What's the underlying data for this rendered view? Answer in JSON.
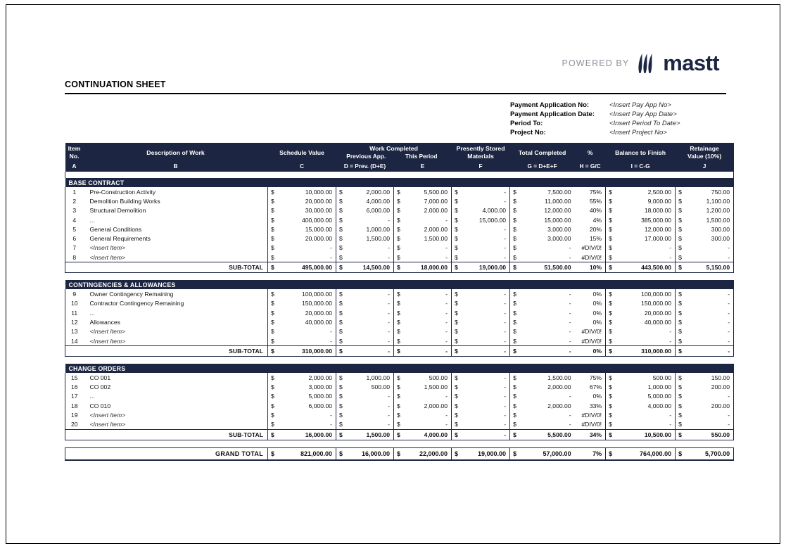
{
  "brand": {
    "powered_by": "POWERED BY",
    "name": "mastt",
    "logo_icon": "mastt-flame-icon",
    "navy": "#1c2642",
    "gray": "#8d9199"
  },
  "page_title": "CONTINUATION SHEET",
  "meta": [
    {
      "label": "Payment Application No:",
      "value": "<Insert Pay App No>"
    },
    {
      "label": "Payment Application Date:",
      "value": "<Insert Pay App Date>"
    },
    {
      "label": "Period To:",
      "value": "<Insert Period To Date>"
    },
    {
      "label": "Project No:",
      "value": "<Insert Project No>"
    }
  ],
  "table": {
    "headers": {
      "item_no_l1": "Item",
      "item_no_l2": "No.",
      "description": "Description of Work",
      "schedule_value": "Schedule Value",
      "work_completed": "Work Completed",
      "previous_app": "Previous App.",
      "this_period": "This Period",
      "stored_l1": "Presently Stored",
      "stored_l2": "Materials",
      "total_completed": "Total Completed",
      "percent": "%",
      "balance_to_finish": "Balance to Finish",
      "retainage_l1": "Retainage",
      "retainage_l2": "Value (10%)"
    },
    "letters": {
      "a": "A",
      "b": "B",
      "c": "C",
      "d": "D = Prev. (D+E)",
      "e": "E",
      "f": "F",
      "g": "G = D+E+F",
      "h": "H = G/C",
      "i": "I = C-G",
      "j": "J"
    },
    "currency_symbol": "$",
    "subtotal_label": "SUB-TOTAL",
    "grand_total_label": "GRAND TOTAL",
    "sections": [
      {
        "title": "BASE CONTRACT",
        "rows": [
          {
            "no": "1",
            "desc": "Pre-Construction Activity",
            "italic": false,
            "sv": "10,000.00",
            "prev": "2,000.00",
            "this": "5,500.00",
            "stored": "-",
            "total": "7,500.00",
            "pct": "75%",
            "bal": "2,500.00",
            "ret": "750.00"
          },
          {
            "no": "2",
            "desc": "Demolition Building Works",
            "italic": false,
            "sv": "20,000.00",
            "prev": "4,000.00",
            "this": "7,000.00",
            "stored": "-",
            "total": "11,000.00",
            "pct": "55%",
            "bal": "9,000.00",
            "ret": "1,100.00"
          },
          {
            "no": "3",
            "desc": "Structural Demolition",
            "italic": false,
            "sv": "30,000.00",
            "prev": "6,000.00",
            "this": "2,000.00",
            "stored": "4,000.00",
            "total": "12,000.00",
            "pct": "40%",
            "bal": "18,000.00",
            "ret": "1,200.00"
          },
          {
            "no": "4",
            "desc": "...",
            "italic": false,
            "sv": "400,000.00",
            "prev": "-",
            "this": "-",
            "stored": "15,000.00",
            "total": "15,000.00",
            "pct": "4%",
            "bal": "385,000.00",
            "ret": "1,500.00"
          },
          {
            "no": "5",
            "desc": "General Conditions",
            "italic": false,
            "sv": "15,000.00",
            "prev": "1,000.00",
            "this": "2,000.00",
            "stored": "-",
            "total": "3,000.00",
            "pct": "20%",
            "bal": "12,000.00",
            "ret": "300.00"
          },
          {
            "no": "6",
            "desc": "General Requirements",
            "italic": false,
            "sv": "20,000.00",
            "prev": "1,500.00",
            "this": "1,500.00",
            "stored": "-",
            "total": "3,000.00",
            "pct": "15%",
            "bal": "17,000.00",
            "ret": "300.00"
          },
          {
            "no": "7",
            "desc": "<Insert Item>",
            "italic": true,
            "sv": "-",
            "prev": "-",
            "this": "-",
            "stored": "-",
            "total": "-",
            "pct": "#DIV/0!",
            "bal": "-",
            "ret": "-"
          },
          {
            "no": "8",
            "desc": "<Insert Item>",
            "italic": true,
            "sv": "-",
            "prev": "-",
            "this": "-",
            "stored": "-",
            "total": "-",
            "pct": "#DIV/0!",
            "bal": "-",
            "ret": "-"
          }
        ],
        "subtotal": {
          "sv": "495,000.00",
          "prev": "14,500.00",
          "this": "18,000.00",
          "stored": "19,000.00",
          "total": "51,500.00",
          "pct": "10%",
          "bal": "443,500.00",
          "ret": "5,150.00"
        }
      },
      {
        "title": "CONTINGENCIES & ALLOWANCES",
        "rows": [
          {
            "no": "9",
            "desc": "Owner Contingency Remaining",
            "italic": false,
            "sv": "100,000.00",
            "prev": "-",
            "this": "-",
            "stored": "-",
            "total": "-",
            "pct": "0%",
            "bal": "100,000.00",
            "ret": "-"
          },
          {
            "no": "10",
            "desc": "Contractor Contingency Remaining",
            "italic": false,
            "sv": "150,000.00",
            "prev": "-",
            "this": "-",
            "stored": "-",
            "total": "-",
            "pct": "0%",
            "bal": "150,000.00",
            "ret": "-"
          },
          {
            "no": "11",
            "desc": "...",
            "italic": false,
            "sv": "20,000.00",
            "prev": "-",
            "this": "-",
            "stored": "-",
            "total": "-",
            "pct": "0%",
            "bal": "20,000.00",
            "ret": "-"
          },
          {
            "no": "12",
            "desc": "Allowances",
            "italic": false,
            "sv": "40,000.00",
            "prev": "-",
            "this": "-",
            "stored": "-",
            "total": "-",
            "pct": "0%",
            "bal": "40,000.00",
            "ret": "-"
          },
          {
            "no": "13",
            "desc": "<Insert Item>",
            "italic": true,
            "sv": "-",
            "prev": "-",
            "this": "-",
            "stored": "-",
            "total": "-",
            "pct": "#DIV/0!",
            "bal": "-",
            "ret": "-"
          },
          {
            "no": "14",
            "desc": "<Insert Item>",
            "italic": true,
            "sv": "-",
            "prev": "-",
            "this": "-",
            "stored": "-",
            "total": "-",
            "pct": "#DIV/0!",
            "bal": "-",
            "ret": "-"
          }
        ],
        "subtotal": {
          "sv": "310,000.00",
          "prev": "-",
          "this": "-",
          "stored": "-",
          "total": "-",
          "pct": "0%",
          "bal": "310,000.00",
          "ret": "-"
        }
      },
      {
        "title": "CHANGE ORDERS",
        "rows": [
          {
            "no": "15",
            "desc": "CO 001",
            "italic": false,
            "sv": "2,000.00",
            "prev": "1,000.00",
            "this": "500.00",
            "stored": "-",
            "total": "1,500.00",
            "pct": "75%",
            "bal": "500.00",
            "ret": "150.00"
          },
          {
            "no": "16",
            "desc": "CO 002",
            "italic": false,
            "sv": "3,000.00",
            "prev": "500.00",
            "this": "1,500.00",
            "stored": "-",
            "total": "2,000.00",
            "pct": "67%",
            "bal": "1,000.00",
            "ret": "200.00"
          },
          {
            "no": "17",
            "desc": "...",
            "italic": false,
            "sv": "5,000.00",
            "prev": "-",
            "this": "-",
            "stored": "-",
            "total": "-",
            "pct": "0%",
            "bal": "5,000.00",
            "ret": "-"
          },
          {
            "no": "18",
            "desc": "CO 010",
            "italic": false,
            "sv": "6,000.00",
            "prev": "-",
            "this": "2,000.00",
            "stored": "-",
            "total": "2,000.00",
            "pct": "33%",
            "bal": "4,000.00",
            "ret": "200.00"
          },
          {
            "no": "19",
            "desc": "<Insert Item>",
            "italic": true,
            "sv": "-",
            "prev": "-",
            "this": "-",
            "stored": "-",
            "total": "-",
            "pct": "#DIV/0!",
            "bal": "-",
            "ret": "-"
          },
          {
            "no": "20",
            "desc": "<Insert Item>",
            "italic": true,
            "sv": "-",
            "prev": "-",
            "this": "-",
            "stored": "-",
            "total": "-",
            "pct": "#DIV/0!",
            "bal": "-",
            "ret": "-"
          }
        ],
        "subtotal": {
          "sv": "16,000.00",
          "prev": "1,500.00",
          "this": "4,000.00",
          "stored": "-",
          "total": "5,500.00",
          "pct": "34%",
          "bal": "10,500.00",
          "ret": "550.00"
        }
      }
    ],
    "grand_total": {
      "sv": "821,000.00",
      "prev": "16,000.00",
      "this": "22,000.00",
      "stored": "19,000.00",
      "total": "57,000.00",
      "pct": "7%",
      "bal": "764,000.00",
      "ret": "5,700.00"
    }
  }
}
